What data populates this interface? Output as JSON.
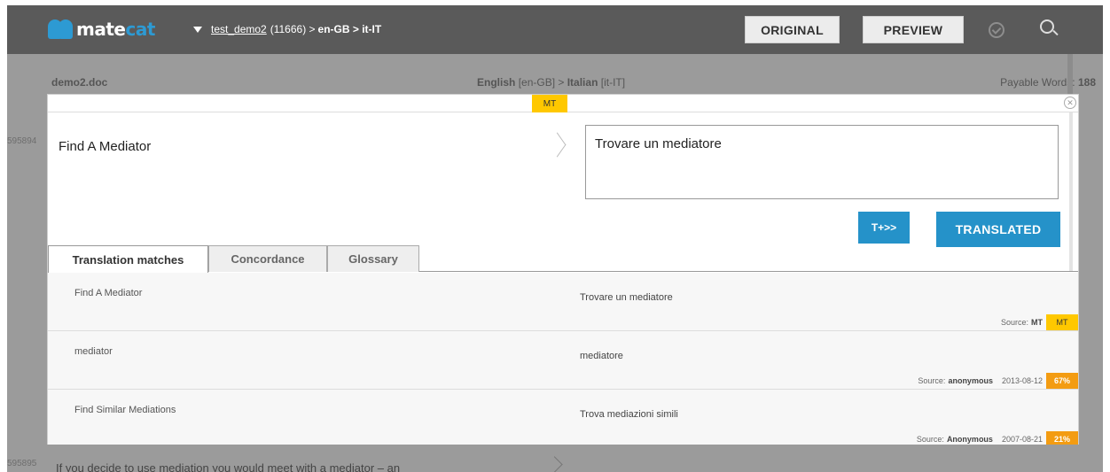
{
  "app": {
    "logo_part1": "mate",
    "logo_part2": "cat"
  },
  "header": {
    "project_name": "test_demo2",
    "project_id": "(11666) > ",
    "language_pair": "en-GB > it-IT",
    "original_button": "ORIGINAL",
    "preview_button": "PREVIEW"
  },
  "file": {
    "name": "demo2.doc",
    "source_lang": "English",
    "source_code": "[en-GB] > ",
    "target_lang": "Italian",
    "target_code": "[it-IT]",
    "payable_label": "Payable Words: ",
    "payable_value": "188"
  },
  "segment": {
    "id": "595894",
    "badge": "MT",
    "source": "Find A Mediator",
    "target": "Trovare un mediatore",
    "tplus_button": "T+>>",
    "translated_button": "TRANSLATED"
  },
  "tabs": [
    {
      "label": "Translation matches"
    },
    {
      "label": "Concordance"
    },
    {
      "label": "Glossary"
    }
  ],
  "matches": [
    {
      "source": "Find A Mediator",
      "target": "Trovare un mediatore",
      "source_label": "Source:",
      "origin": "MT",
      "date": "",
      "score": "MT"
    },
    {
      "source": "mediator",
      "target": "mediatore",
      "source_label": "Source:",
      "origin": "anonymous",
      "date": "2013-08-12",
      "score": "67%"
    },
    {
      "source": "Find Similar Mediations",
      "target": "Trova mediazioni simili",
      "source_label": "Source:",
      "origin": "Anonymous",
      "date": "2007-08-21",
      "score": "21%"
    }
  ],
  "next_segment": {
    "id": "595895",
    "source": "If you decide to use mediation you would meet with a mediator – an"
  },
  "colors": {
    "accent": "#2592c9",
    "mt_badge": "#ffc800",
    "score_orange": "#f39c12"
  }
}
